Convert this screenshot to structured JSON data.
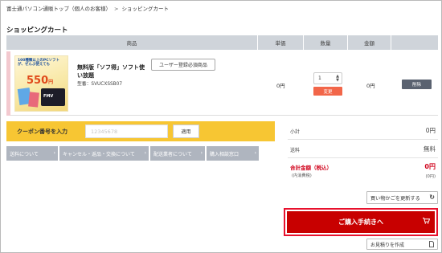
{
  "breadcrumb": {
    "home": "富士通パソコン通販トップ（個人のお客様）",
    "separator": ">",
    "current": "ショッピングカート"
  },
  "page_title": "ショッピングカート",
  "table_headers": {
    "item": "商品",
    "unit_price": "単価",
    "quantity": "数量",
    "amount": "金額"
  },
  "cart_item": {
    "image": {
      "top_text": "100種類以上のPCソフトが、ぜんぶ使えても",
      "price": "550",
      "price_unit": "円",
      "brand": "FMV"
    },
    "name": "無料版「ソフ得」ソフト使い放題",
    "model_label": "型番：",
    "model": "SVUCXSSB07",
    "tag": "ユーザー登録必須商品",
    "unit_price": "0円",
    "quantity": "1",
    "change_label": "変更",
    "amount": "0円",
    "delete_label": "削除"
  },
  "coupon": {
    "label": "クーポン番号を入力",
    "placeholder": "12345678",
    "apply_label": "適用"
  },
  "info_links": [
    {
      "label": "送料について"
    },
    {
      "label": "キャンセル・返品・交換について"
    },
    {
      "label": "配送業者について"
    },
    {
      "label": "購入相談窓口"
    }
  ],
  "summary": {
    "subtotal_label": "小計",
    "subtotal_value": "0円",
    "shipping_label": "送料",
    "shipping_value": "無料",
    "total_label": "合計金額（税込）",
    "total_sub": "(内消費税)",
    "total_value": "0円",
    "tax_value": "(0円)"
  },
  "buttons": {
    "update_cart": "買い物かごを更新する",
    "checkout": "ご購入手続きへ",
    "estimate": "お見積りを作成"
  },
  "colors": {
    "accent_red": "#c80000",
    "coupon_yellow": "#f7c633",
    "change_orange": "#f26649",
    "header_gray": "#cfd4da",
    "link_gray": "#afb5bf"
  }
}
